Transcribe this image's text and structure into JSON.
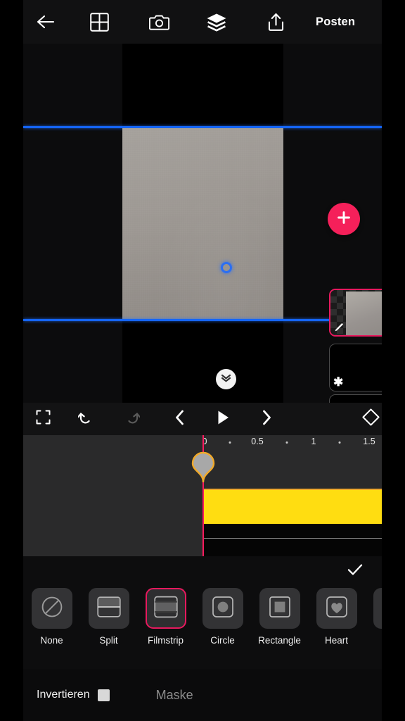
{
  "app": {
    "accent_pink": "#e6195e",
    "fab_pink": "#f5205a",
    "guide_blue": "#1565f5",
    "clip_yellow": "#ffdd11",
    "playhead_pink": "#ff1a5e"
  },
  "topbar": {
    "back_icon": "arrow-left-icon",
    "grid_icon": "grid-icon",
    "camera_icon": "camera-icon",
    "layers_icon": "layers-icon",
    "share_icon": "share-upload-icon",
    "post_label": "Posten"
  },
  "canvas": {
    "anchor_icon": "anchor-point-icon",
    "collapse_icon": "chevron-double-down-icon",
    "guide_top_label": "top-guide",
    "guide_bottom_label": "bottom-guide"
  },
  "layers": {
    "add_label": "+",
    "add_icon": "plus-icon",
    "items": [
      {
        "name": "layer-image-selected",
        "selected": true,
        "image_badge": "image-icon",
        "corner_badge": "pencil-icon"
      },
      {
        "name": "layer-mask",
        "selected": false,
        "image_badge": "image-icon",
        "corner_badge": "asterisk-icon"
      },
      {
        "name": "layer-empty",
        "selected": false,
        "image_badge": "",
        "corner_badge": ""
      }
    ]
  },
  "timeline_toolbar": {
    "fullscreen_icon": "fullscreen-icon",
    "undo_icon": "undo-icon",
    "redo_icon": "redo-icon",
    "prev_icon": "previous-frame-icon",
    "play_icon": "play-icon",
    "next_icon": "next-frame-icon",
    "keyframe_icon": "keyframe-diamond-icon"
  },
  "timeline": {
    "ruler_ticks": [
      "0",
      "0.5",
      "1",
      "1.5"
    ],
    "playhead_time": "0",
    "playhead_icon": "playhead-marker-icon",
    "clip_name": "video-clip"
  },
  "mask_panel": {
    "confirm_icon": "check-icon",
    "options": [
      {
        "label": "None",
        "icon": "no-mask-icon",
        "selected": false
      },
      {
        "label": "Split",
        "icon": "split-mask-icon",
        "selected": false
      },
      {
        "label": "Filmstrip",
        "icon": "filmstrip-mask-icon",
        "selected": true
      },
      {
        "label": "Circle",
        "icon": "circle-mask-icon",
        "selected": false
      },
      {
        "label": "Rectangle",
        "icon": "rectangle-mask-icon",
        "selected": false
      },
      {
        "label": "Heart",
        "icon": "heart-mask-icon",
        "selected": false
      }
    ]
  },
  "bottombar": {
    "invert_label": "Invertieren",
    "invert_checked": false,
    "mask_label": "Maske"
  }
}
